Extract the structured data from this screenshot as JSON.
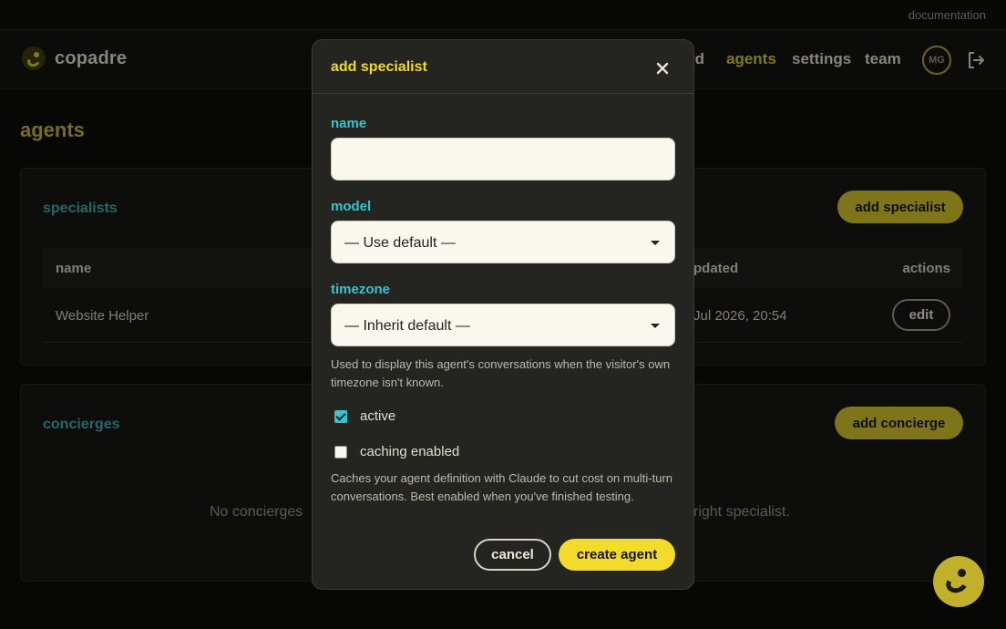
{
  "topbar": {
    "documentation": "documentation"
  },
  "brand": {
    "name": "copadre"
  },
  "nav": {
    "dashboard_partial": "rd",
    "agents": "agents",
    "settings": "settings",
    "team": "team",
    "avatar_initials": "MG"
  },
  "page": {
    "title": "agents"
  },
  "specialists": {
    "title": "specialists",
    "add_button": "add specialist",
    "columns": {
      "name": "name",
      "updated_partial": "pdated",
      "actions": "actions"
    },
    "rows": [
      {
        "name": "Website Helper",
        "updated_partial": "Jul 2026, 20:54",
        "action": "edit"
      }
    ]
  },
  "concierges": {
    "title": "concierges",
    "add_button": "add concierge",
    "empty_left": "No concierges",
    "empty_right": "right specialist."
  },
  "modal": {
    "title": "add specialist",
    "name_label": "name",
    "name_value": "",
    "model_label": "model",
    "model_value": "— Use default —",
    "timezone_label": "timezone",
    "timezone_value": "— Inherit default —",
    "timezone_help": "Used to display this agent's conversations when the visitor's own timezone isn't known.",
    "active_label": "active",
    "active_checked": true,
    "caching_label": "caching enabled",
    "caching_checked": false,
    "caching_help": "Caches your agent definition with Claude to cut cost on multi-turn conversations. Best enabled when you've finished testing.",
    "cancel": "cancel",
    "create": "create agent"
  },
  "colors": {
    "accent": "#f2db2b",
    "teal": "#37c3cd",
    "brand": "#c2b228"
  },
  "icons": {
    "close": "close-icon",
    "logout": "logout-icon",
    "logo": "copadre-logo-icon",
    "caret": "chevron-down-icon",
    "chat": "chat-launcher-icon"
  }
}
